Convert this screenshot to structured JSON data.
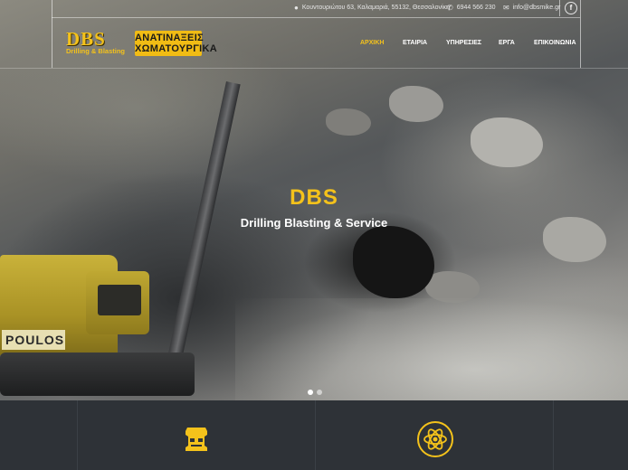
{
  "topbar": {
    "address": "Κουντουριώτου 63, Καλαμαριά, 55132, Θεσσαλονίκη",
    "phone": "6944 566 230",
    "email": "info@dbsmike.gr",
    "icons": {
      "address": "map-marker-icon",
      "phone": "phone-icon",
      "email": "envelope-icon",
      "social": "facebook-icon"
    },
    "facebook_glyph": "f"
  },
  "logo": {
    "brand": "DBS",
    "tagline": "Drilling & Blasting",
    "greek_line1": "ΑΝΑΤΙΝΑΞΕΙΣ",
    "greek_line2": "ΧΩΜΑΤΟΥΡΓΙΚΑ"
  },
  "nav": {
    "items": [
      {
        "label": "ΑΡΧΙΚΗ",
        "active": true
      },
      {
        "label": "ΕΤΑΙΡΙΑ",
        "active": false
      },
      {
        "label": "ΥΠΗΡΕΣΙΕΣ",
        "active": false
      },
      {
        "label": "ΕΡΓΑ",
        "active": false
      },
      {
        "label": "ΕΠΙΚΟΙΝΩΝΙΑ",
        "active": false
      }
    ]
  },
  "hero": {
    "title": "DBS",
    "subtitle": "Drilling Blasting & Service",
    "excavator_label": "POULOS",
    "slides": 2,
    "active_slide": 1
  },
  "features": {
    "icons": [
      "shield-badge-icon",
      "atom-icon"
    ]
  },
  "colors": {
    "accent": "#f4c21b",
    "footer_bg": "#2e3237",
    "text_light": "#ffffff"
  }
}
